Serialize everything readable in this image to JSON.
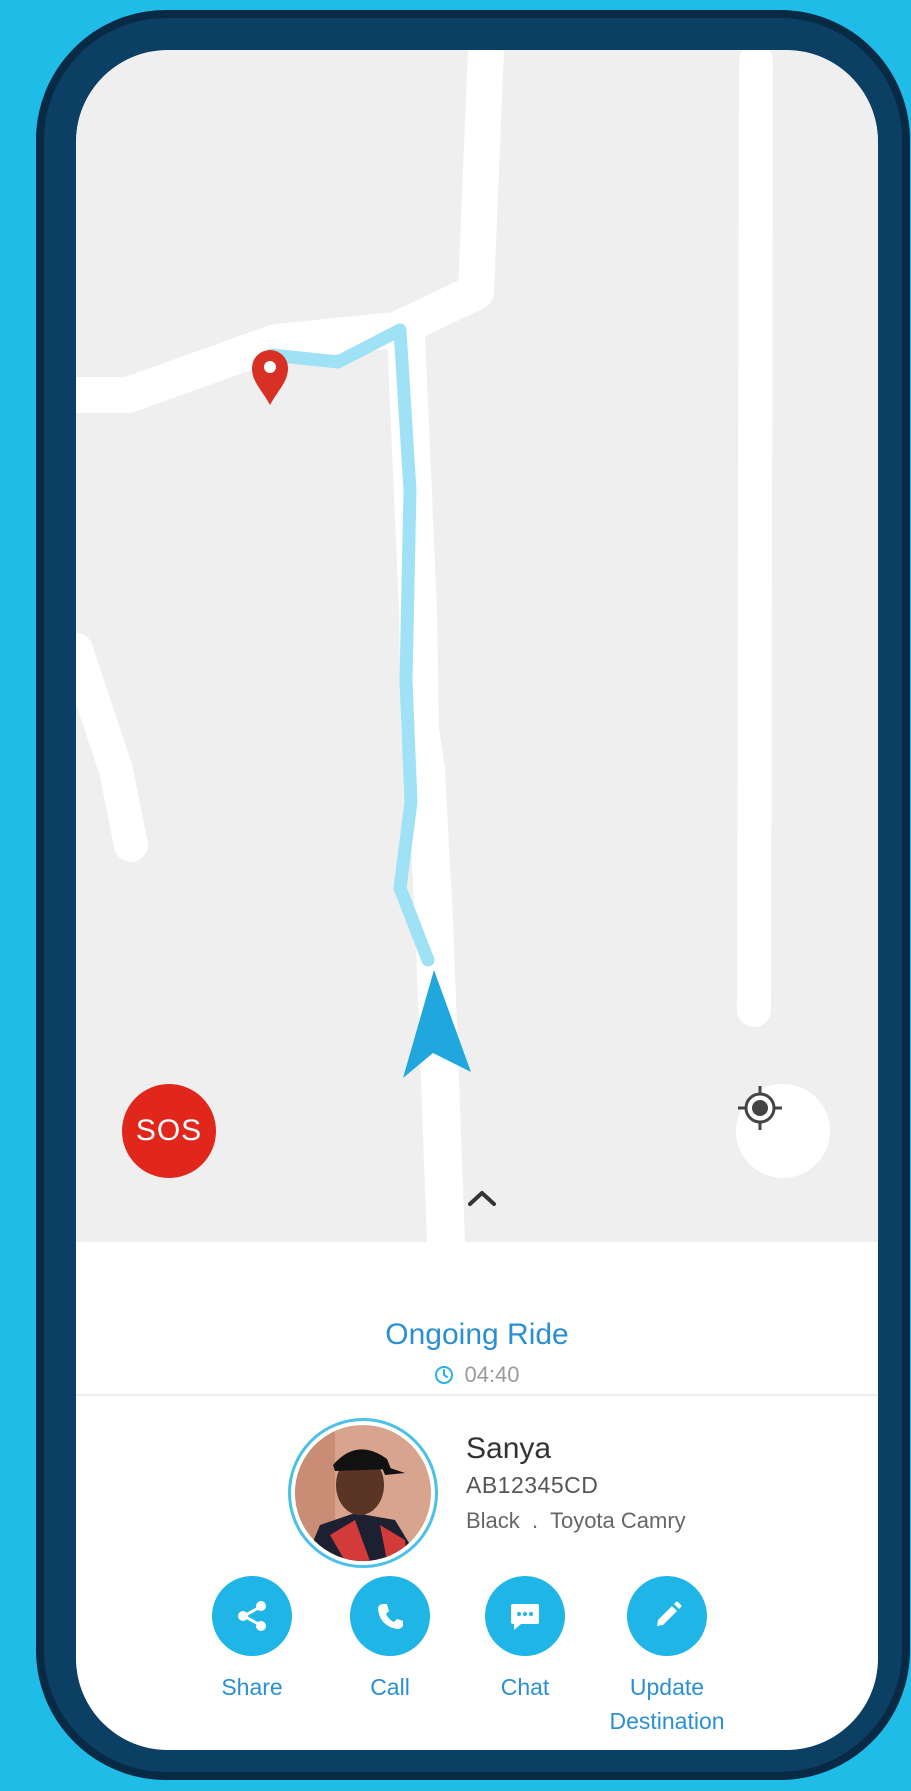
{
  "map": {
    "sos_label": "SOS",
    "locate_icon": "crosshair-icon",
    "expand_icon": "chevron-up-icon",
    "colors": {
      "background": "#efefef",
      "road": "#ffffff",
      "route": "#9fe2f6",
      "vehicle": "#20a8de",
      "pin": "#d93025"
    }
  },
  "ride": {
    "status": "Ongoing Ride",
    "time": "04:40",
    "time_icon": "clock-icon"
  },
  "driver": {
    "name": "Sanya",
    "plate": "AB12345CD",
    "car": "Black  .  Toyota Camry"
  },
  "actions": [
    {
      "label": "Share",
      "icon": "share-icon"
    },
    {
      "label": "Call",
      "icon": "phone-icon"
    },
    {
      "label": "Chat",
      "icon": "chat-icon"
    },
    {
      "label": "Update Destination",
      "icon": "pencil-icon"
    }
  ],
  "colors": {
    "page_background": "#20bce8",
    "phone_frame": "#0b3f63",
    "accent": "#1fb5e6",
    "accent_text": "#2b8fd6",
    "sos": "#e1261c"
  }
}
